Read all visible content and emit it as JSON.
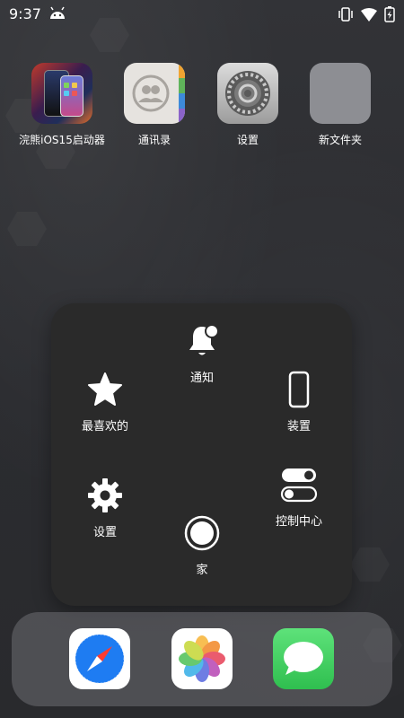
{
  "status_bar": {
    "time": "9:37",
    "icons": [
      "android-icon",
      "vibrate-icon",
      "wifi-icon",
      "battery-charging-icon"
    ]
  },
  "home_apps": [
    {
      "name": "ios15-launcher",
      "label": "浣熊iOS15启动器"
    },
    {
      "name": "contacts",
      "label": "通讯录"
    },
    {
      "name": "settings",
      "label": "设置"
    },
    {
      "name": "new-folder",
      "label": "新文件夹"
    }
  ],
  "assistive_menu": {
    "notifications": "通知",
    "favorites": "最喜欢的",
    "device": "装置",
    "settings": "设置",
    "control_center": "控制中心",
    "home": "家"
  },
  "dock": [
    "safari-icon",
    "photos-icon",
    "messages-icon"
  ],
  "colors": {
    "wallpaper": "#2f3033",
    "panel": "#2a2a2a",
    "messages_green": "#35c759",
    "safari_blue": "#1e7cf2"
  }
}
